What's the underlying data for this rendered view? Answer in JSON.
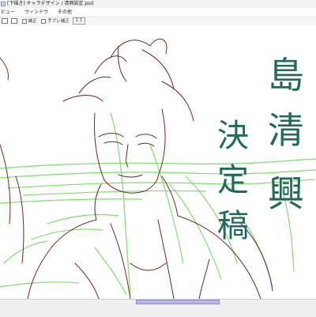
{
  "window": {
    "title": "[下描き] キャラデザイン / 清興設定.psd"
  },
  "menu": {
    "items": [
      "ビュー",
      "ウィンドウ",
      "その他"
    ]
  },
  "toolbar": {
    "stabilizer_label": "補正",
    "scale_label": "手ブレ補正",
    "scale_value": "1:1"
  },
  "canvas_notes": {
    "name": "島 清興",
    "status": "決定稿",
    "ink_color": "#1f6b5a"
  },
  "colors": {
    "line_art": "#7a2424",
    "guide_lines": "#7be06a"
  },
  "scroll": {
    "position": 0.5
  }
}
